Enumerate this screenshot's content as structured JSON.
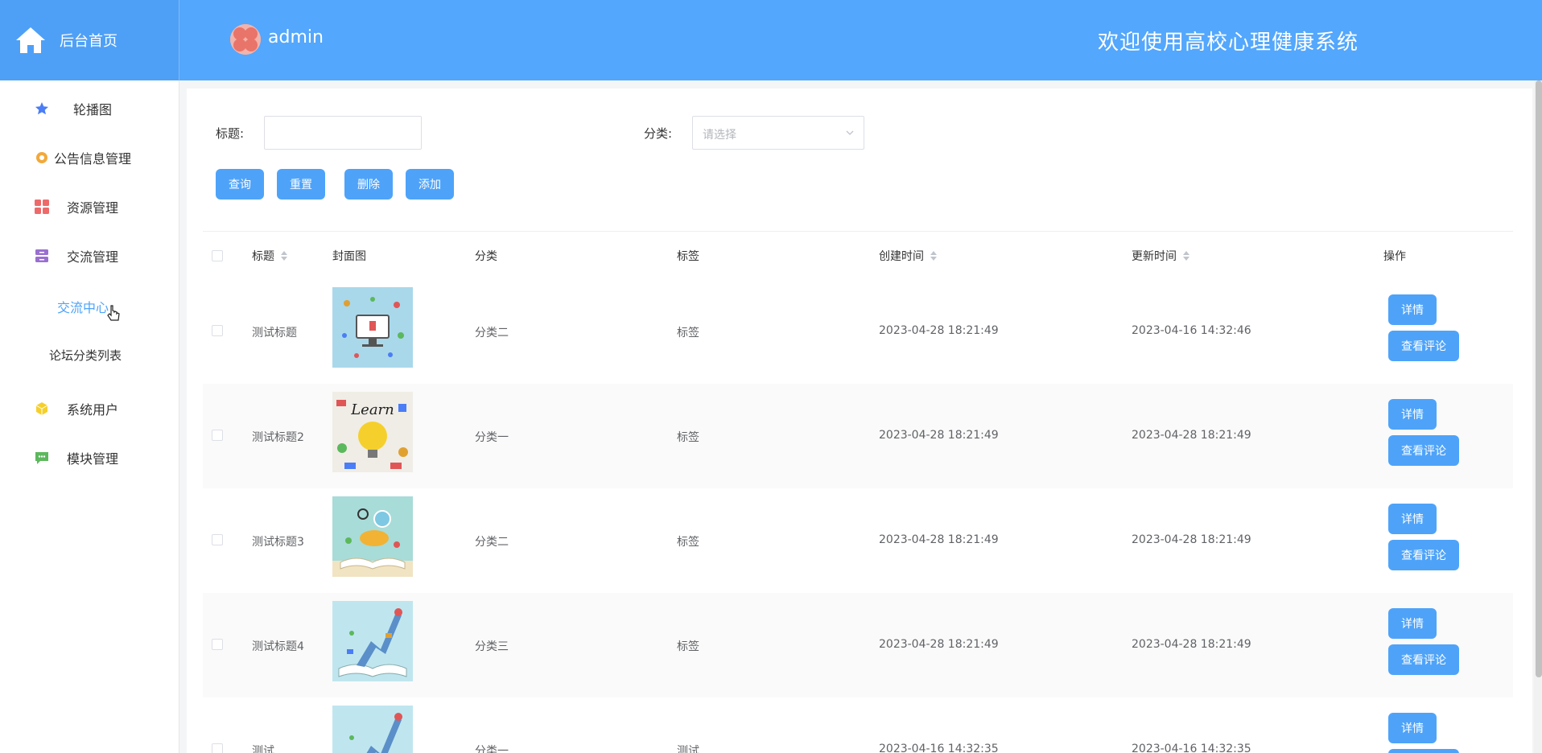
{
  "header": {
    "home_label": "后台首页",
    "admin_name": "admin",
    "welcome": "欢迎使用高校心理健康系统"
  },
  "sidebar": {
    "items": [
      {
        "label": "轮播图",
        "icon": "star-icon",
        "color": "#4a7df6"
      },
      {
        "label": "公告信息管理",
        "icon": "gear-icon",
        "color": "#f2a93b"
      },
      {
        "label": "资源管理",
        "icon": "grid-icon",
        "color": "#ee6a6a"
      },
      {
        "label": "交流管理",
        "icon": "archive-icon",
        "color": "#9a6fd0"
      },
      {
        "label": "系统用户",
        "icon": "cube-icon",
        "color": "#f5d02c"
      },
      {
        "label": "模块管理",
        "icon": "chat-icon",
        "color": "#5cb85c"
      }
    ],
    "sub_items": [
      {
        "label": "交流中心",
        "active": true
      },
      {
        "label": "论坛分类列表",
        "active": false
      }
    ]
  },
  "search": {
    "title_label": "标题:",
    "title_value": "",
    "category_label": "分类:",
    "category_placeholder": "请选择"
  },
  "buttons": {
    "query": "查询",
    "reset": "重置",
    "delete": "删除",
    "add": "添加"
  },
  "table": {
    "columns": [
      "标题",
      "封面图",
      "分类",
      "标签",
      "创建时间",
      "更新时间",
      "操作"
    ],
    "rows": [
      {
        "title": "测试标题",
        "category": "分类二",
        "tag": "标签",
        "created": "2023-04-28 18:21:49",
        "updated": "2023-04-16 14:32:46",
        "image": "computer-illustration"
      },
      {
        "title": "测试标题2",
        "category": "分类一",
        "tag": "标签",
        "created": "2023-04-28 18:21:49",
        "updated": "2023-04-28 18:21:49",
        "image": "learn-lightbulb"
      },
      {
        "title": "测试标题3",
        "category": "分类二",
        "tag": "标签",
        "created": "2023-04-28 18:21:49",
        "updated": "2023-04-28 18:21:49",
        "image": "open-book-balloon"
      },
      {
        "title": "测试标题4",
        "category": "分类三",
        "tag": "标签",
        "created": "2023-04-28 18:21:49",
        "updated": "2023-04-28 18:21:49",
        "image": "book-rocket"
      },
      {
        "title": "测试",
        "category": "分类一",
        "tag": "测试",
        "created": "2023-04-16 14:32:35",
        "updated": "2023-04-16 14:32:35",
        "image": "book-rocket"
      }
    ],
    "action_detail": "详情",
    "action_comments": "查看评论"
  },
  "colors": {
    "header_bg": "#53a7fc",
    "button_bg": "#4ea3f9",
    "active_sub": "#4ea3f9"
  }
}
